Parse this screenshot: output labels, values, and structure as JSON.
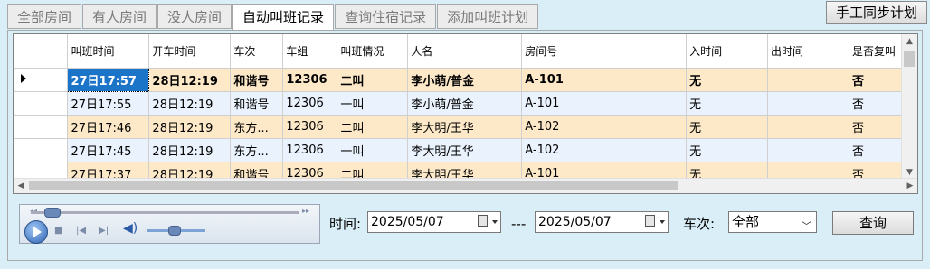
{
  "tabs": [
    {
      "label": "全部房间",
      "active": false
    },
    {
      "label": "有人房间",
      "active": false
    },
    {
      "label": "没人房间",
      "active": false
    },
    {
      "label": "自动叫班记录",
      "active": true
    },
    {
      "label": "查询住宿记录",
      "active": false
    },
    {
      "label": "添加叫班计划",
      "active": false
    }
  ],
  "sync_button": "手工同步计划",
  "grid": {
    "columns": [
      "叫班时间",
      "开车时间",
      "车次",
      "车组",
      "叫班情况",
      "人名",
      "房间号",
      "入时间",
      "出时间",
      "是否复叫"
    ],
    "rows": [
      {
        "style": "orange",
        "bold": true,
        "selected": true,
        "cells": [
          "27日17:57",
          "28日12:19",
          "和谐号",
          "12306",
          "二叫",
          "李小萌/普金",
          "A-101",
          "无",
          "",
          "否"
        ]
      },
      {
        "style": "blue",
        "bold": false,
        "selected": false,
        "cells": [
          "27日17:55",
          "28日12:19",
          "和谐号",
          "12306",
          "一叫",
          "李小萌/普金",
          "A-101",
          "无",
          "",
          "否"
        ]
      },
      {
        "style": "orange",
        "bold": false,
        "selected": false,
        "cells": [
          "27日17:46",
          "28日12:19",
          "东方...",
          "12306",
          "二叫",
          "李大明/王华",
          "A-102",
          "无",
          "",
          "否"
        ]
      },
      {
        "style": "blue",
        "bold": false,
        "selected": false,
        "cells": [
          "27日17:45",
          "28日12:19",
          "东方...",
          "12306",
          "一叫",
          "李大明/王华",
          "A-102",
          "无",
          "",
          "否"
        ]
      },
      {
        "style": "orange",
        "bold": false,
        "selected": false,
        "cells": [
          "27日17:37",
          "28日12:19",
          "和谐号",
          "12306",
          "二叫",
          "李大明/王华",
          "A-101",
          "无",
          "",
          "否"
        ]
      }
    ]
  },
  "filter": {
    "time_label": "时间:",
    "date_from": "2025/05/07",
    "separator": "---",
    "date_to": "2025/05/07",
    "train_label": "车次:",
    "train_value": "全部",
    "query_button": "查询"
  },
  "player": {
    "progress": 0.05,
    "volume": 0.45
  },
  "colors": {
    "background": "#d9eef7",
    "row_orange": "#fde9c8",
    "row_blue": "#eaf2fd",
    "selection": "#1c74c9"
  }
}
